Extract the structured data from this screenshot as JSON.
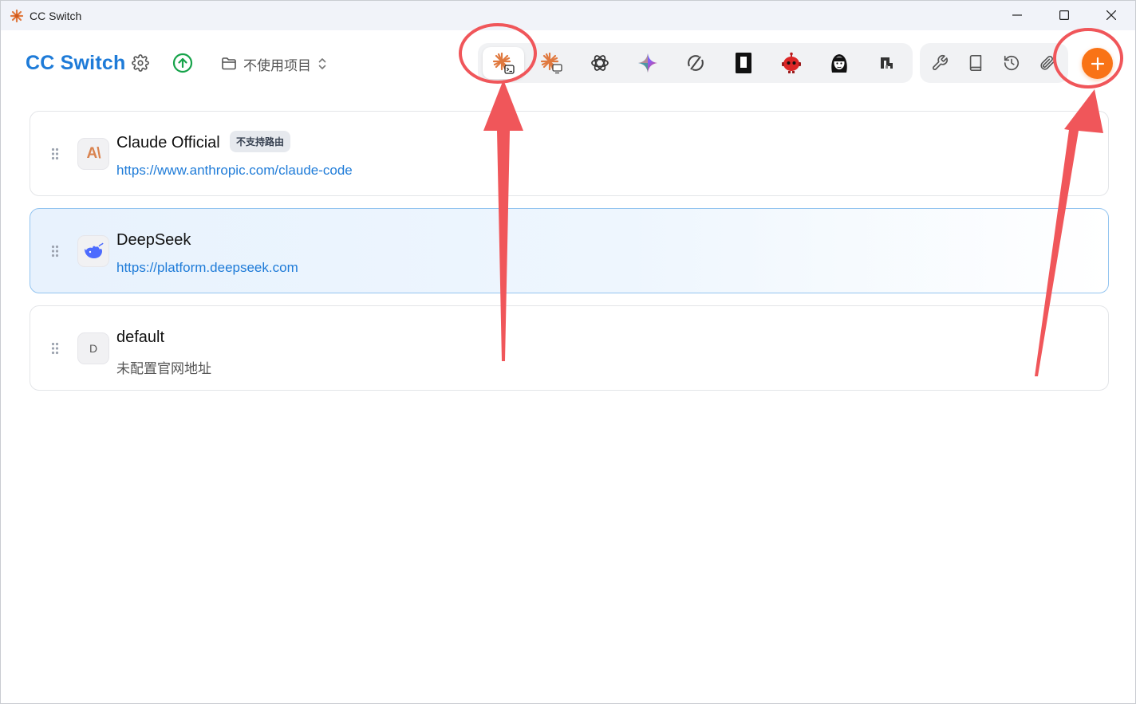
{
  "window": {
    "title": "CC Switch"
  },
  "header": {
    "brand": "CC Switch",
    "project_select_label": "不使用项目"
  },
  "providers": [
    {
      "name": "Claude Official",
      "badge": "不支持路由",
      "url": "https://www.anthropic.com/claude-code",
      "avatar_text": "A\\",
      "active": false
    },
    {
      "name": "DeepSeek",
      "url": "https://platform.deepseek.com",
      "active": true
    },
    {
      "name": "default",
      "url": "未配置官网地址",
      "avatar_text": "D",
      "active": false
    }
  ],
  "colors": {
    "brand": "#1e7bd8",
    "accent": "#f97316",
    "annotation": "#f0565a",
    "active_card_border": "#93c4f0"
  },
  "icons": {
    "app_tabs": [
      "claude-code-icon",
      "claude-desktop-icon",
      "openai-icon",
      "gemini-icon",
      "opencode-icon",
      "terminal-app-icon",
      "red-robot-icon",
      "girl-avatar-icon",
      "pixel-logo-icon"
    ],
    "tools": [
      "wrench-icon",
      "book-icon",
      "history-icon",
      "paperclip-icon"
    ]
  }
}
